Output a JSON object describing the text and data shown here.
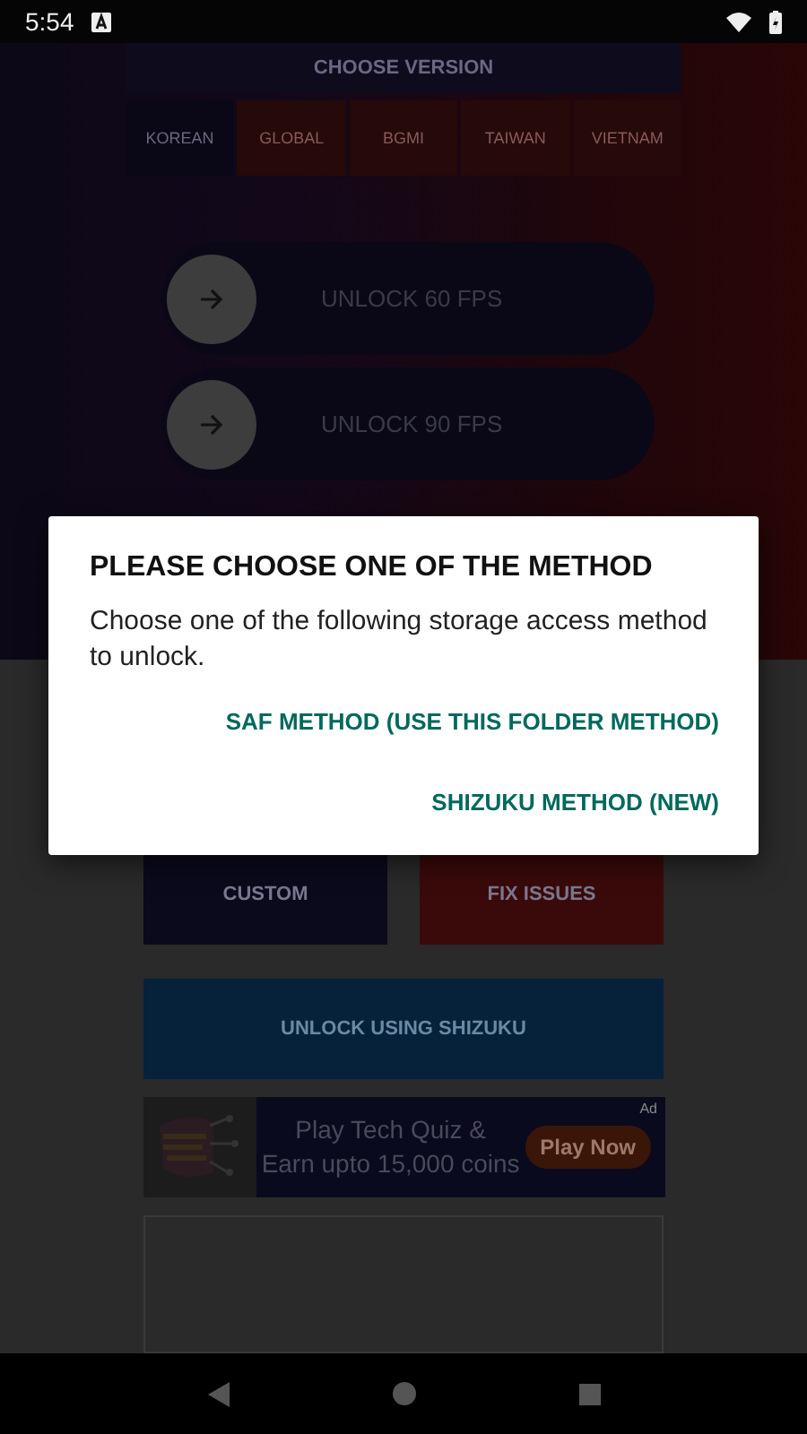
{
  "status_bar": {
    "time": "5:54"
  },
  "version_picker": {
    "title": "CHOOSE VERSION",
    "tabs": [
      {
        "label": "KOREAN",
        "selected": true
      },
      {
        "label": "GLOBAL",
        "selected": false
      },
      {
        "label": "BGMI",
        "selected": false
      },
      {
        "label": "TAIWAN",
        "selected": false
      },
      {
        "label": "VIETNAM",
        "selected": false
      }
    ]
  },
  "unlock_buttons": [
    {
      "label": "UNLOCK 60 FPS"
    },
    {
      "label": "UNLOCK 90 FPS"
    }
  ],
  "tool_buttons": [
    {
      "label": "CUSTOM",
      "color": "#0b0a1c"
    },
    {
      "label": "FIX ISSUES",
      "color": "#3a0a0a"
    }
  ],
  "shizuku_button": {
    "label": "UNLOCK USING SHIZUKU"
  },
  "ad": {
    "lines": [
      "Play Tech Quiz &",
      "Earn upto 15,000 coins"
    ],
    "cta": "Play Now",
    "badge": "Ad"
  },
  "dialog": {
    "title": "PLEASE CHOOSE ONE OF THE METHOD",
    "message": "Choose one of the following storage access method to unlock.",
    "actions": [
      "SAF METHOD (USE THIS FOLDER METHOD)",
      "SHIZUKU METHOD (NEW)"
    ]
  }
}
